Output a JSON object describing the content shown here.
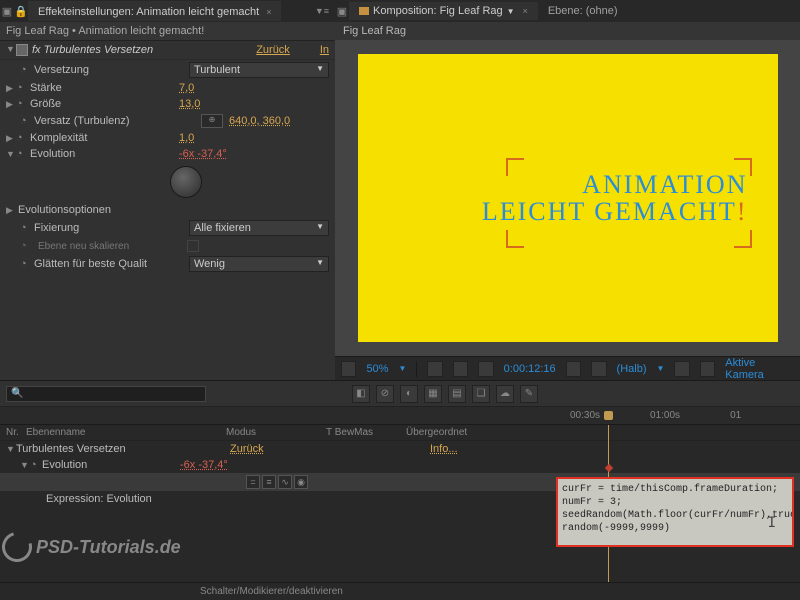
{
  "panel": {
    "tab": "Effekteinstellungen: Animation leicht gemacht",
    "breadcrumb": "Fig Leaf Rag • Animation leicht gemacht!"
  },
  "effect": {
    "name": "Turbulentes Versetzen",
    "reset": "Zurück",
    "inst": "In",
    "props": [
      {
        "label": "Versetzung",
        "value": "Turbulent",
        "type": "select"
      },
      {
        "label": "Stärke",
        "value": "7,0"
      },
      {
        "label": "Größe",
        "value": "13,0"
      },
      {
        "label": "Versatz (Turbulenz)",
        "value": "640,0, 360,0",
        "prefix": "pos"
      },
      {
        "label": "Komplexität",
        "value": "1,0"
      },
      {
        "label": "Evolution",
        "value": "-6x -37,4°",
        "expr": true
      },
      {
        "label": "Evolutionsoptionen"
      },
      {
        "label": "Fixierung",
        "value": "Alle fixieren",
        "type": "select"
      },
      {
        "label": "Ebene neu skalieren",
        "disabled": true
      },
      {
        "label": "Glätten für beste Qualit",
        "value": "Wenig",
        "type": "select"
      }
    ]
  },
  "viewer": {
    "tabs": {
      "comp": "Komposition: Fig Leaf Rag",
      "layer": "Ebene: (ohne)"
    },
    "compname": "Fig Leaf Rag",
    "canvas": {
      "line1": "ANIMATION",
      "line2": "LEICHT GEMACHT",
      "excl": "!"
    },
    "ctrl": {
      "zoom": "50%",
      "time": "0:00:12:16",
      "res": "(Halb)",
      "cam": "Aktive Kamera"
    }
  },
  "timeline": {
    "ruler": [
      "00:30s",
      "01:00s",
      "01"
    ],
    "cols": {
      "nr": "Nr.",
      "name": "Ebenenname",
      "mode": "Modus",
      "tbw": "T  BewMas",
      "parent": "Übergeordnet"
    },
    "rows": [
      {
        "name": "Turbulentes Versetzen",
        "right": "Zurück",
        "info": "Info..."
      },
      {
        "name": "Evolution",
        "value": "-6x -37,4°"
      },
      {
        "name": "Expression: Evolution"
      }
    ],
    "exprIcons": [
      "=",
      "≡",
      "∿",
      "◉"
    ],
    "expression": "curFr = time/thisComp.frameDuration;\nnumFr = 3;\nseedRandom(Math.floor(curFr/numFr),true);\nrandom(-9999,9999)"
  },
  "watermark": "PSD-Tutorials.de",
  "footer": "Schalter/Modikierer/deaktivieren"
}
